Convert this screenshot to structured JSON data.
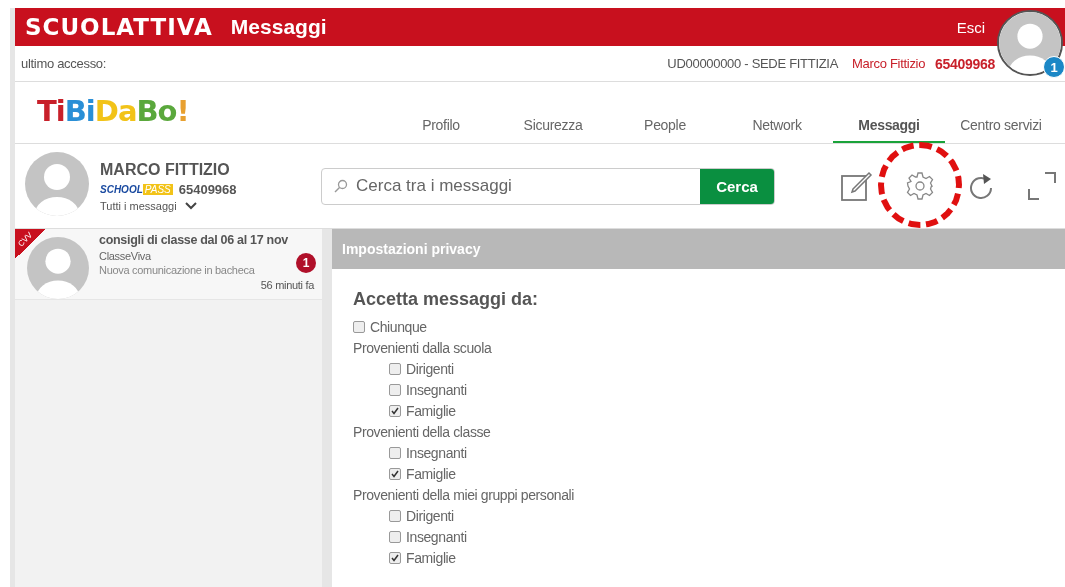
{
  "header": {
    "brand": "SCUOLATTIVA",
    "title": "Messaggi",
    "logout": "Esci",
    "notification_count": "1"
  },
  "info_bar": {
    "last_access": "ultimo accesso:",
    "school": "UD00000000 - SEDE FITTIZIA",
    "user_name": "Marco Fittizio",
    "user_code": "65409968"
  },
  "nav": {
    "logo": "TiBiDaBo!",
    "tabs": [
      {
        "label": "Profilo",
        "selected": false
      },
      {
        "label": "Sicurezza",
        "selected": false
      },
      {
        "label": "People",
        "selected": false
      },
      {
        "label": "Network",
        "selected": false
      },
      {
        "label": "Messaggi",
        "selected": true
      },
      {
        "label": "Centro servizi",
        "selected": false
      }
    ]
  },
  "user": {
    "name": "MARCO FITTIZIO",
    "pass_logo": [
      "SCHOOL",
      "PASS"
    ],
    "code": "65409968",
    "filter": "Tutti i messaggi"
  },
  "search": {
    "placeholder": "Cerca tra i messaggi",
    "button": "Cerca"
  },
  "messages": [
    {
      "ribbon": "CVV",
      "title": "consigli di classe dal 06 al 17 nov",
      "sender": "ClasseViva",
      "preview": "Nuova comunicazione in bacheca",
      "time": "56 minuti fa",
      "unread": "1"
    }
  ],
  "panel": {
    "title": "Impostazioni privacy",
    "heading": "Accetta messaggi da:",
    "options": [
      {
        "kind": "checkbox",
        "label": "Chiunque",
        "checked": false
      },
      {
        "kind": "group",
        "label": "Provenienti dalla scuola",
        "children": [
          {
            "kind": "checkbox",
            "label": "Dirigenti",
            "checked": false
          },
          {
            "kind": "checkbox",
            "label": "Insegnanti",
            "checked": false
          },
          {
            "kind": "checkbox",
            "label": "Famiglie",
            "checked": true
          }
        ]
      },
      {
        "kind": "group",
        "label": "Provenienti della classe",
        "children": [
          {
            "kind": "checkbox",
            "label": "Insegnanti",
            "checked": false
          },
          {
            "kind": "checkbox",
            "label": "Famiglie",
            "checked": true
          }
        ]
      },
      {
        "kind": "group",
        "label": "Provenienti della miei gruppi personali",
        "children": [
          {
            "kind": "checkbox",
            "label": "Dirigenti",
            "checked": false
          },
          {
            "kind": "checkbox",
            "label": "Insegnanti",
            "checked": false
          },
          {
            "kind": "checkbox",
            "label": "Famiglie",
            "checked": true
          }
        ]
      }
    ]
  }
}
